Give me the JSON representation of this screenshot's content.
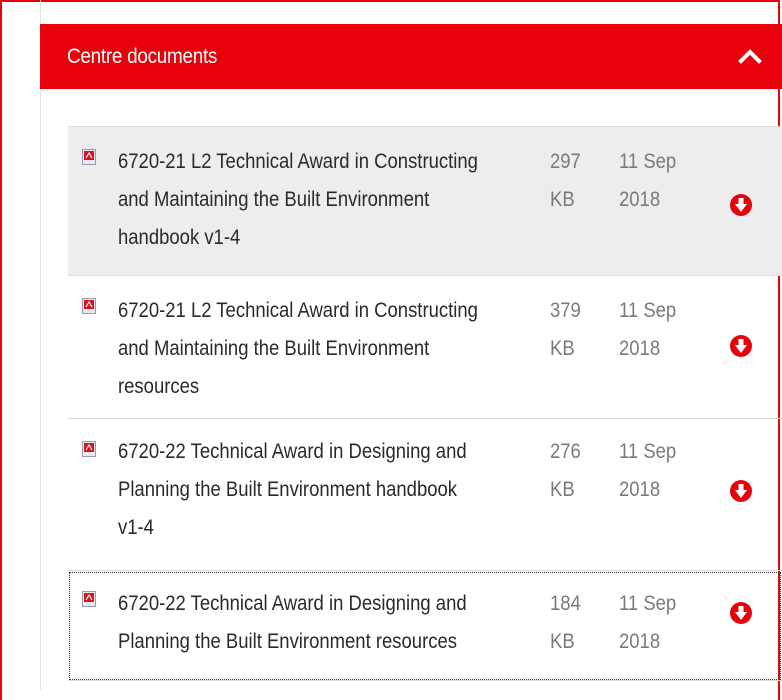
{
  "header": {
    "title": "Centre documents",
    "toggle_icon": "chevron-up-icon"
  },
  "colors": {
    "accent": "#e8000b",
    "row_shaded": "#ededed",
    "text": "#2a2a2a",
    "meta_text": "#7a7a7a"
  },
  "documents": [
    {
      "title_lines": [
        "6720-21 L2 Technical Award in Constructing",
        "and Maintaining the Built Environment",
        "handbook v1-4"
      ],
      "size_value": "297",
      "size_unit": "KB",
      "date_day_month": "11 Sep",
      "date_year": "2018",
      "icon": "pdf-icon",
      "action_icon": "download-icon"
    },
    {
      "title_lines": [
        "6720-21 L2 Technical Award in Constructing",
        "and Maintaining the Built Environment",
        "resources"
      ],
      "size_value": "379",
      "size_unit": "KB",
      "date_day_month": "11 Sep",
      "date_year": "2018",
      "icon": "pdf-icon",
      "action_icon": "download-icon"
    },
    {
      "title_lines": [
        "6720-22 Technical Award in Designing and",
        "Planning the Built Environment handbook",
        "v1-4"
      ],
      "size_value": "276",
      "size_unit": "KB",
      "date_day_month": "11 Sep",
      "date_year": "2018",
      "icon": "pdf-icon",
      "action_icon": "download-icon"
    },
    {
      "title_lines": [
        "6720-22 Technical Award in Designing and",
        "Planning the Built Environment resources"
      ],
      "size_value": "184",
      "size_unit": "KB",
      "date_day_month": "11 Sep",
      "date_year": "2018",
      "icon": "pdf-icon",
      "action_icon": "download-icon"
    }
  ]
}
